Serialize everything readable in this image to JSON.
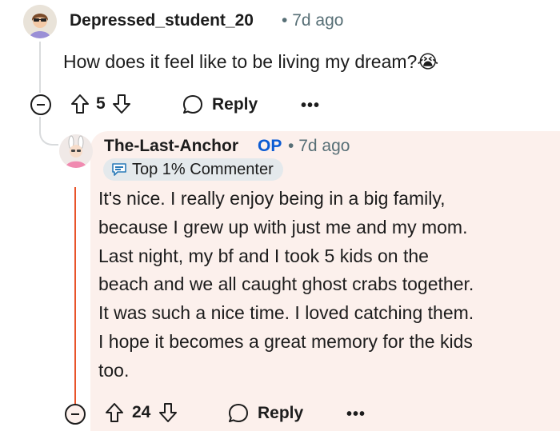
{
  "comment": {
    "username": "Depressed_student_20",
    "separator": "•",
    "time": "7d ago",
    "body": "How does it feel like to be living my dream?",
    "emoji": "😭",
    "votes": "5",
    "reply_label": "Reply",
    "more_label": "•••"
  },
  "reply": {
    "username": "The-Last-Anchor",
    "op_tag": "OP",
    "separator": "•",
    "time": "7d ago",
    "badge": "Top 1% Commenter",
    "body_lines": [
      "It's nice. I really enjoy being in a big family,",
      "because I grew up with just me and my mom.",
      "Last night, my bf and I took 5 kids on the",
      "beach and we all caught ghost crabs together.",
      "It was such a nice time. I loved catching them.",
      "I hope it becomes a great memory for the kids",
      "too."
    ],
    "votes": "24",
    "reply_label": "Reply",
    "more_label": "•••"
  },
  "colors": {
    "op": "#0b5bd3",
    "thread_accent": "#e8542a",
    "card_bg": "#fcf0ec",
    "meta": "#576f76"
  }
}
